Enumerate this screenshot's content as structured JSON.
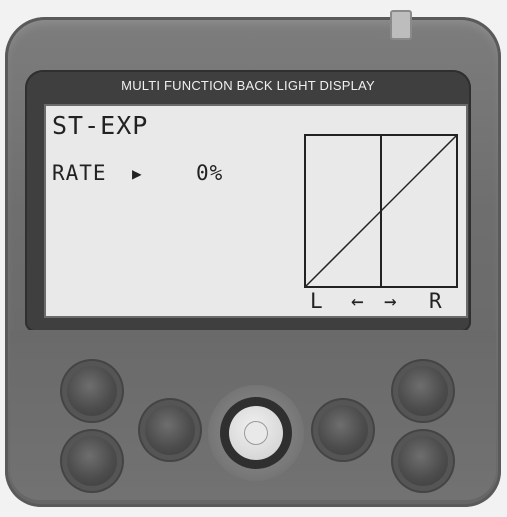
{
  "device": {
    "bezel_title": "MULTI FUNCTION BACK LIGHT DISPLAY"
  },
  "lcd": {
    "title": "ST-EXP",
    "rate_label": "RATE",
    "rate_value": "0%",
    "graph_labels": {
      "left": "L",
      "left_arrow": "←",
      "right_arrow": "→",
      "right": "R"
    }
  },
  "icons": {
    "rate_arrow": "triangle-right-icon",
    "dial": "jog-dial-icon"
  }
}
